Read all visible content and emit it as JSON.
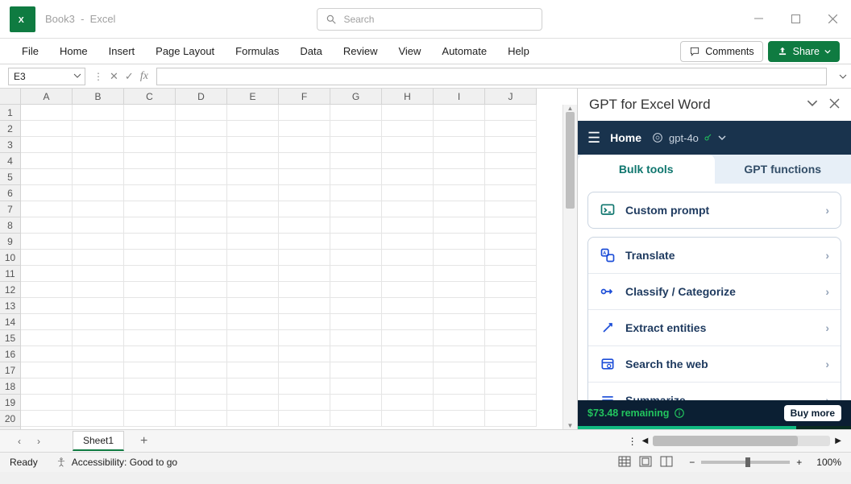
{
  "title": {
    "doc": "Book3",
    "app": "Excel"
  },
  "search_placeholder": "Search",
  "ribbon_tabs": [
    "File",
    "Home",
    "Insert",
    "Page Layout",
    "Formulas",
    "Data",
    "Review",
    "View",
    "Automate",
    "Help"
  ],
  "comments_label": "Comments",
  "share_label": "Share",
  "name_box": "E3",
  "columns": [
    "A",
    "B",
    "C",
    "D",
    "E",
    "F",
    "G",
    "H",
    "I",
    "J"
  ],
  "rows": [
    1,
    2,
    3,
    4,
    5,
    6,
    7,
    8,
    9,
    10,
    11,
    12,
    13,
    14,
    15,
    16,
    17,
    18,
    19,
    20
  ],
  "pane": {
    "title": "GPT for Excel Word",
    "home_label": "Home",
    "model": "gpt-4o",
    "tabs": {
      "bulk": "Bulk tools",
      "functions": "GPT functions"
    },
    "tools_group1": [
      {
        "label": "Custom prompt"
      }
    ],
    "tools_group2": [
      {
        "label": "Translate"
      },
      {
        "label": "Classify / Categorize"
      },
      {
        "label": "Extract entities"
      },
      {
        "label": "Search the web"
      },
      {
        "label": "Summarize"
      }
    ],
    "remaining": "$73.48 remaining",
    "buy": "Buy more"
  },
  "sheet_tab": "Sheet1",
  "status": {
    "ready": "Ready",
    "accessibility": "Accessibility: Good to go",
    "zoom": "100%"
  }
}
